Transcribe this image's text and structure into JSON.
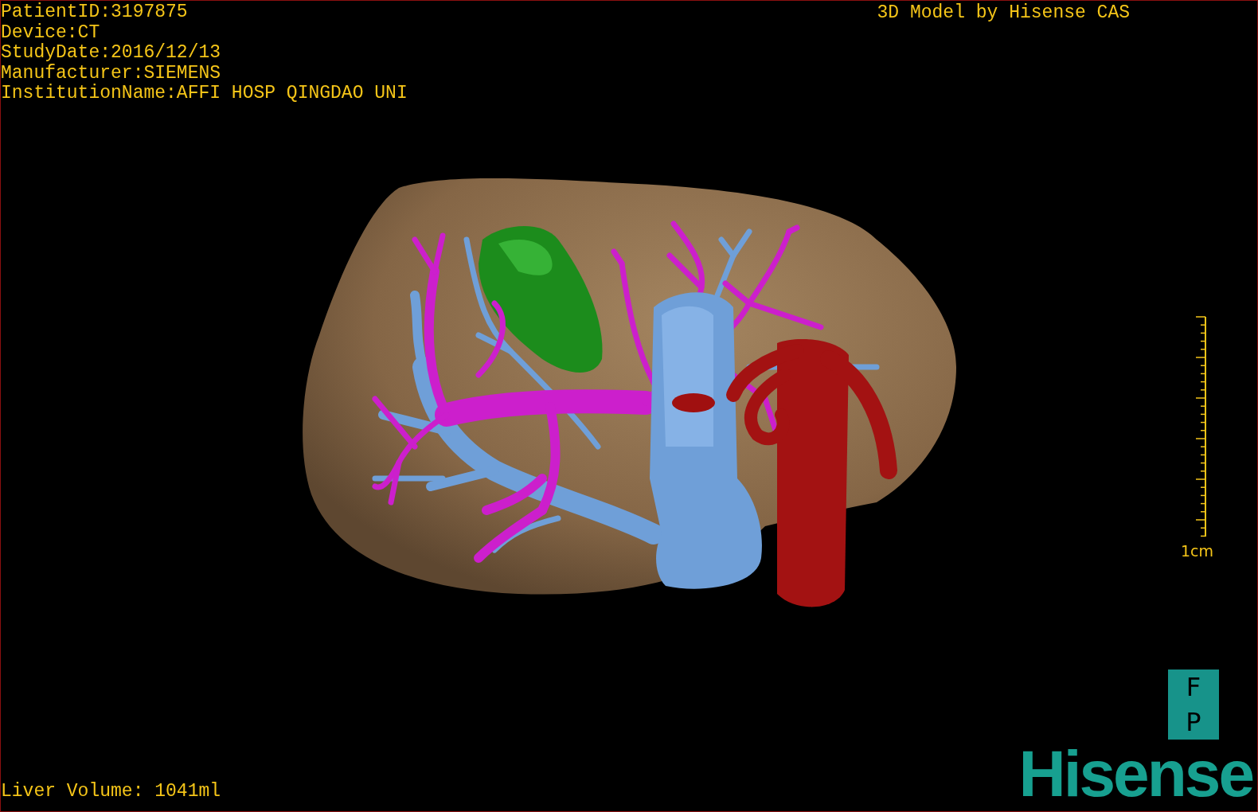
{
  "header": {
    "info_lines": [
      "PatientID:3197875",
      "Device:CT",
      "StudyDate:2016/12/13",
      "Manufacturer:SIEMENS",
      "InstitutionName:AFFI HOSP QINGDAO UNI"
    ],
    "title": "3D Model by Hisense CAS"
  },
  "scale": {
    "label": "1cm"
  },
  "orientation": {
    "labels": [
      "F",
      "P"
    ]
  },
  "logo": {
    "text": "Hisense"
  },
  "footer": {
    "volume": "Liver Volume: 1041ml"
  }
}
